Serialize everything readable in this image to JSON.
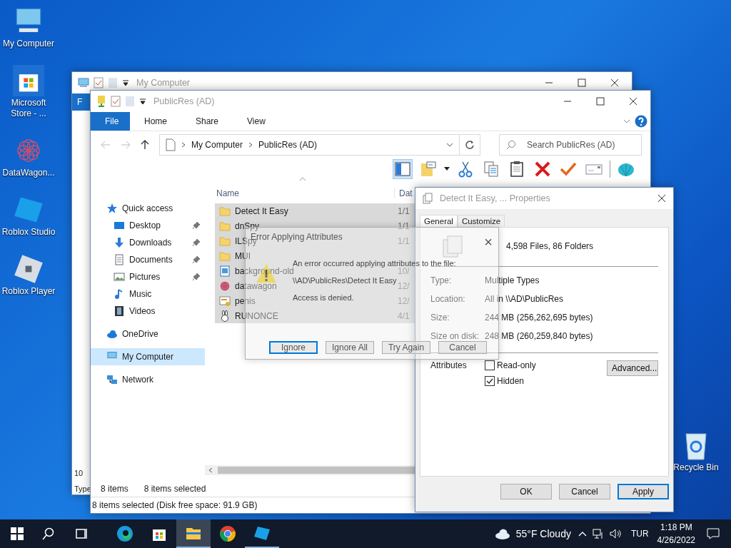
{
  "desktop_icons": [
    {
      "label": "My Computer",
      "kind": "computer"
    },
    {
      "label": "Microsoft Store - ...",
      "kind": "store"
    },
    {
      "label": "DataWagon...",
      "kind": "flower"
    },
    {
      "label": "Roblox Studio",
      "kind": "studio"
    },
    {
      "label": "Roblox Player",
      "kind": "player"
    }
  ],
  "recycle_bin": {
    "label": "Recycle Bin"
  },
  "back_window": {
    "title": "My Computer",
    "ribbon_tab": "F",
    "fragments": [
      "10",
      "Type"
    ]
  },
  "explorer": {
    "title": "PublicRes (AD)",
    "ribbon_tabs": [
      {
        "label": "File",
        "selected": true
      },
      {
        "label": "Home",
        "selected": false
      },
      {
        "label": "Share",
        "selected": false
      },
      {
        "label": "View",
        "selected": false
      }
    ],
    "breadcrumb": [
      "My Computer",
      "PublicRes (AD)"
    ],
    "search": {
      "placeholder": "Search PublicRes (AD)"
    },
    "toolbar": [
      {
        "kind": "pane",
        "selected": true
      },
      {
        "kind": "folder-props",
        "selected": false
      },
      {
        "kind": "cut",
        "selected": false
      },
      {
        "kind": "copy",
        "selected": false
      },
      {
        "kind": "paste",
        "selected": false
      },
      {
        "kind": "delete",
        "selected": false
      },
      {
        "kind": "check",
        "selected": false
      },
      {
        "kind": "envelope",
        "selected": false
      },
      {
        "kind": "shell",
        "selected": false
      }
    ],
    "nav": [
      {
        "label": "Quick access",
        "kind": "star",
        "selected": false,
        "children": [
          {
            "label": "Desktop",
            "kind": "desktop",
            "pinned": true,
            "selected": false
          },
          {
            "label": "Downloads",
            "kind": "download",
            "pinned": true,
            "selected": false
          },
          {
            "label": "Documents",
            "kind": "document",
            "pinned": true,
            "selected": false
          },
          {
            "label": "Pictures",
            "kind": "pictures",
            "pinned": true,
            "selected": false
          },
          {
            "label": "Music",
            "kind": "music",
            "pinned": false,
            "selected": false
          },
          {
            "label": "Videos",
            "kind": "video",
            "pinned": false,
            "selected": false
          }
        ]
      },
      {
        "label": "OneDrive",
        "kind": "cloud",
        "selected": false
      },
      {
        "label": "My Computer",
        "kind": "computer",
        "selected": true
      },
      {
        "label": "Network",
        "kind": "network",
        "selected": false
      }
    ],
    "columns": [
      "Name",
      "Dat"
    ],
    "rows": [
      {
        "name": "Detect It Easy",
        "date": "1/1",
        "kind": "folder",
        "selected": true
      },
      {
        "name": "dnSpy",
        "date": "1/1",
        "kind": "folder",
        "selected": true
      },
      {
        "name": "ILSpy",
        "date": "1/1",
        "kind": "folder",
        "selected": true
      },
      {
        "name": "MUI",
        "kind": "folder",
        "selected": true
      },
      {
        "name": "background-old",
        "date": "10/",
        "kind": "image",
        "selected": true
      },
      {
        "name": "datawagon",
        "date": "12/",
        "kind": "flower",
        "selected": true
      },
      {
        "name": "penis",
        "date": "12/",
        "kind": "script",
        "selected": true
      },
      {
        "name": "RUNONCE",
        "date": "4/1",
        "kind": "rabbit",
        "selected": true
      }
    ],
    "status": [
      "8 items",
      "8 items selected"
    ],
    "footer": "8 items selected (Disk free space: 91.9 GB)"
  },
  "properties": {
    "title": "Detect It Easy, ... Properties",
    "tabs": [
      {
        "label": "General",
        "selected": true
      },
      {
        "label": "Customize",
        "selected": false
      }
    ],
    "summary": "4,598 Files, 86 Folders",
    "fields": [
      {
        "label": "Type:",
        "value": "Multiple Types"
      },
      {
        "label": "Location:",
        "value": "All in \\\\AD\\PublicRes"
      },
      {
        "label": "Size:",
        "value": "244 MB (256,262,695 bytes)"
      },
      {
        "label": "Size on disk:",
        "value": "248 MB (260,259,840 bytes)"
      }
    ],
    "attributes_label": "Attributes",
    "attributes": [
      {
        "label": "Read-only",
        "checked": false
      },
      {
        "label": "Hidden",
        "checked": true
      }
    ],
    "advanced_button": "Advanced...",
    "buttons": [
      {
        "label": "OK",
        "default": false
      },
      {
        "label": "Cancel",
        "default": false
      },
      {
        "label": "Apply",
        "default": true
      }
    ]
  },
  "error_dialog": {
    "title": "Error Applying Attributes",
    "close": "×",
    "message": "An error occurred applying attributes to the file:",
    "path": "\\\\AD\\PublicRes\\Detect It Easy",
    "detail": "Access is denied.",
    "buttons": [
      {
        "label": "Ignore",
        "default": true
      },
      {
        "label": "Ignore All",
        "default": false
      },
      {
        "label": "Try Again",
        "default": false
      },
      {
        "label": "Cancel",
        "default": false
      }
    ]
  },
  "taskbar": {
    "apps": [
      {
        "kind": "edge",
        "active": false,
        "running": false
      },
      {
        "kind": "store",
        "active": false,
        "running": false
      },
      {
        "kind": "explorer",
        "active": true,
        "running": true
      },
      {
        "kind": "chrome",
        "active": false,
        "running": false
      },
      {
        "kind": "studio",
        "active": false,
        "running": true
      }
    ],
    "weather": "55°F Cloudy",
    "language": "TUR",
    "time": "1:18 PM",
    "date": "4/26/2022"
  }
}
